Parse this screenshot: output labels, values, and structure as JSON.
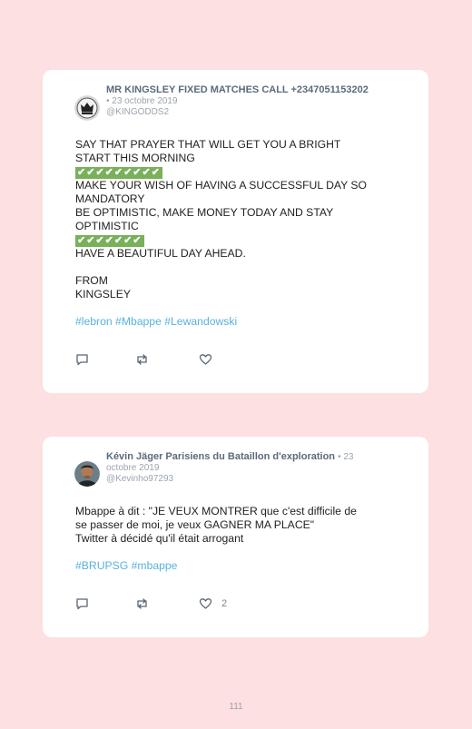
{
  "tweets": [
    {
      "author": "MR KINGSLEY FIXED MATCHES CALL +2347051153202",
      "date": "• 23 octobre 2019",
      "handle": "@KINGODDS2",
      "lines": [
        "SAY THAT PRAYER THAT WILL GET YOU A BRIGHT",
        "START THIS MORNING",
        "✔✔✔✔✔✔✔✔✔",
        "MAKE YOUR WISH OF HAVING A SUCCESSFUL DAY SO",
        "MANDATORY",
        "BE OPTIMISTIC, MAKE MONEY TODAY AND STAY",
        "OPTIMISTIC",
        "✔✔✔✔✔✔✔",
        "HAVE A BEAUTIFUL DAY AHEAD.",
        "",
        "FROM",
        "KINGSLEY",
        "",
        "#lebron #Mbappe #Lewandowski"
      ],
      "like_count": ""
    },
    {
      "author": "Kévin Jäger Parisiens du Bataillon d'exploration",
      "date": "• 23",
      "date2": "octobre 2019",
      "handle": "@Kevinho97293",
      "lines": [
        "Mbappe à dit : \"JE VEUX MONTRER que c'est difficile de",
        "se passer de moi, je veux GAGNER MA PLACE\"",
        "Twitter à décidé qu'il était arrogant",
        "",
        "#BRUPSG #mbappe"
      ],
      "like_count": "2"
    }
  ],
  "page_number": "111",
  "colors": {
    "background": "#fde0e1",
    "hashtag": "#58b2dc",
    "check_badge": "#78b159"
  }
}
